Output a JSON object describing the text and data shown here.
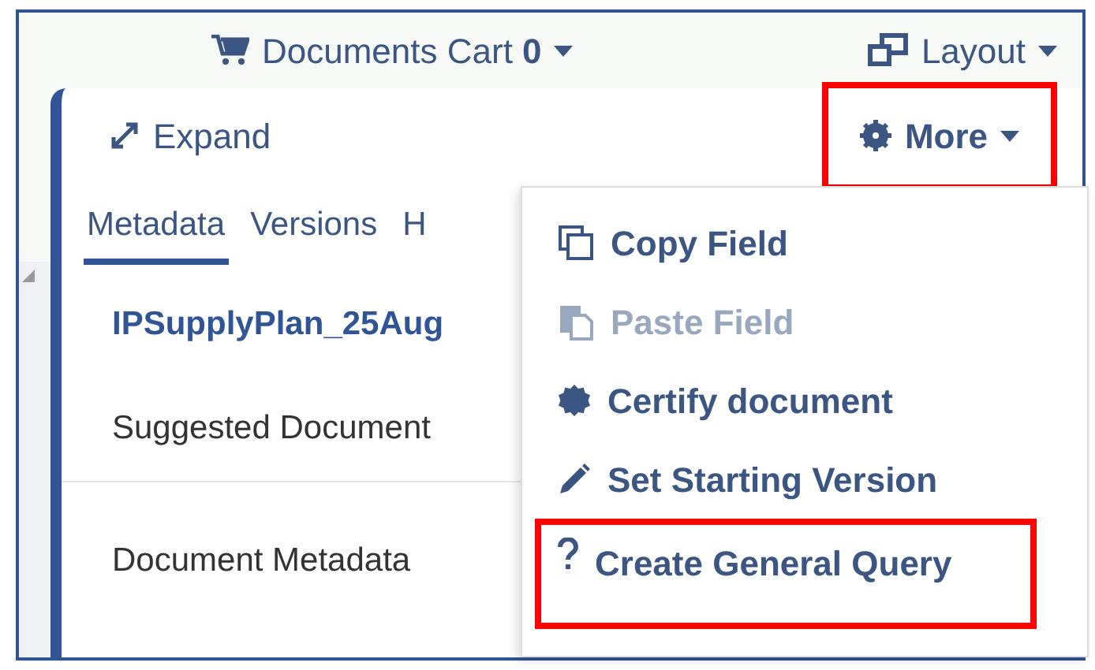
{
  "top_bar": {
    "cart": {
      "label": "Documents Cart",
      "count": "0"
    },
    "layout": {
      "label": "Layout"
    }
  },
  "toolbar": {
    "expand": "Expand",
    "more": {
      "label": "More",
      "highlighted": true,
      "expanded": true
    }
  },
  "tabs": [
    {
      "label": "Metadata",
      "selected": true
    },
    {
      "label": "Versions",
      "selected": false
    },
    {
      "label": "H",
      "selected": false
    }
  ],
  "document": {
    "title": "IPSupplyPlan_25Aug",
    "fields": [
      "Suggested Document",
      "Document Metadata"
    ]
  },
  "menu": [
    {
      "kind": "copy",
      "label": "Copy Field",
      "disabled": false,
      "highlighted": false
    },
    {
      "kind": "paste",
      "label": "Paste Field",
      "disabled": true,
      "highlighted": false
    },
    {
      "kind": "certify",
      "label": "Certify document",
      "disabled": false,
      "highlighted": false
    },
    {
      "kind": "edit",
      "label": "Set Starting Version",
      "disabled": false,
      "highlighted": false
    },
    {
      "kind": "query",
      "label": "Create General Query",
      "disabled": false,
      "highlighted": true
    }
  ]
}
